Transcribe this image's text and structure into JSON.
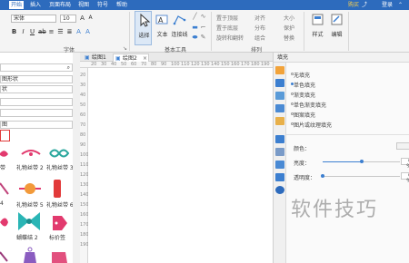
{
  "menubar": {
    "items": [
      "开始",
      "插入",
      "页面布局",
      "视图",
      "符号",
      "帮助"
    ],
    "right_labels": [
      "购买",
      "登录"
    ],
    "brand_color": "#2d6bbd"
  },
  "ribbon": {
    "font_name": "宋体",
    "font_size": "10",
    "font_group_label": "字体",
    "tools_group_label": "基本工具",
    "arrange_group_label": "排列",
    "select_label": "选择",
    "text_label": "文本",
    "connector_label": "连接线",
    "arrange_items": [
      "置于顶层",
      "置于底层",
      "旋转和翻转",
      "对齐",
      "分布",
      "组合",
      "大小",
      "保护",
      "替换"
    ],
    "style_label": "样式",
    "edit_label": "编辑"
  },
  "left_panel": {
    "search_value": "",
    "rows": [
      "图形状",
      "状",
      "",
      "",
      "图"
    ],
    "shape_labels": [
      "带",
      "礼物丝带 2",
      "礼物丝带 3",
      "4",
      "礼物丝带 5",
      "礼物丝带 6",
      "",
      "蝴蝶结 2",
      "标价签"
    ]
  },
  "canvas": {
    "tabs": [
      "绘图1",
      "绘图2"
    ],
    "active_tab": 1,
    "ruler_numbers": [
      "20",
      "30",
      "40",
      "50",
      "60",
      "70",
      "80",
      "90",
      "100",
      "110",
      "120",
      "130",
      "140",
      "150",
      "160",
      "170",
      "180",
      "190"
    ]
  },
  "right_panel": {
    "title": "填充",
    "fill_options": [
      "无填充",
      "单色填充",
      "渐变填充",
      "单色渐变填充",
      "图案填充",
      "图片或纹理填充"
    ],
    "selected_fill": 1,
    "color_label": "颜色：",
    "brightness_label": "亮度：",
    "brightness_value": "0 %",
    "brightness_level": 0.5,
    "transparency_label": "透明度：",
    "transparency_value": "0 %",
    "transparency_level": 0.0
  },
  "watermark": "软件技巧"
}
